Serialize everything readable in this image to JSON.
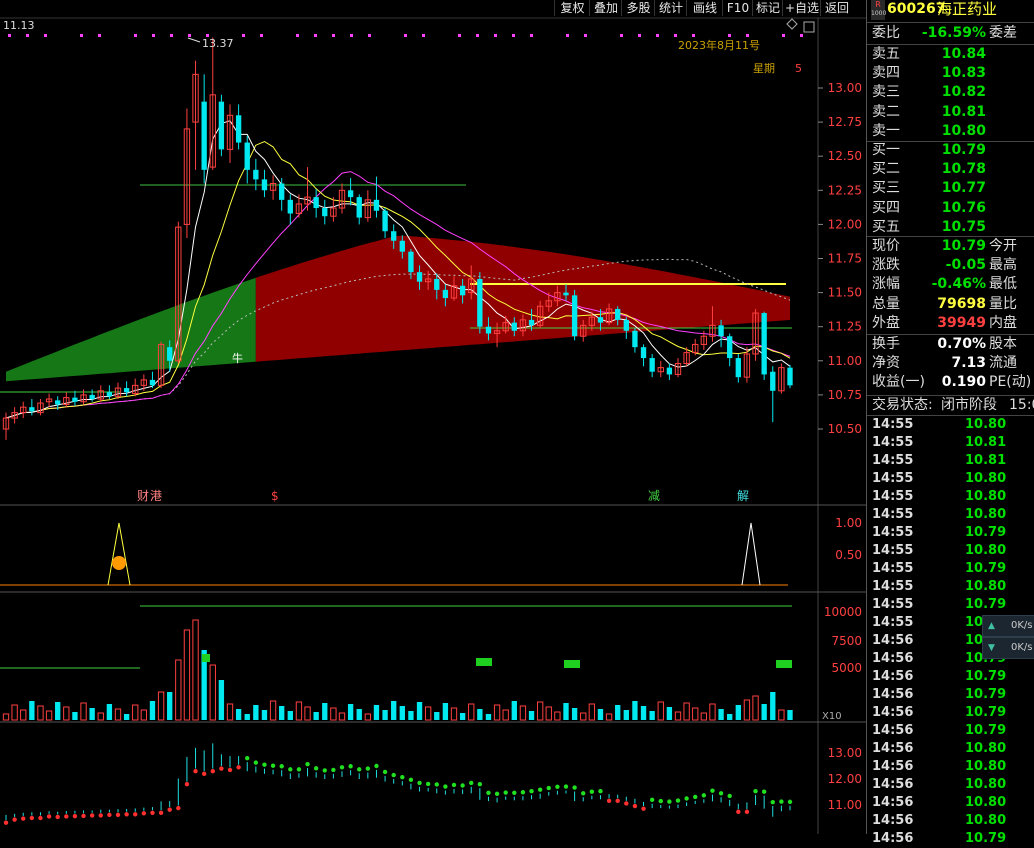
{
  "toolbar": {
    "items": [
      "复权",
      "叠加",
      "多股",
      "统计",
      "画线",
      "F10",
      "标记",
      "+自选",
      "返回"
    ]
  },
  "chart": {
    "price_top_left": "11.13",
    "high_label": "13.37",
    "date_label": "2023年8月11号",
    "weekday_label": "星期",
    "weekday_value": "5",
    "markers": [
      {
        "text": "财"
      },
      {
        "text": "港"
      },
      {
        "text": "$"
      },
      {
        "text": "减"
      },
      {
        "text": "解"
      }
    ],
    "bull_label": "牛",
    "vol_scale_label": "X10",
    "price_axis": [
      "13.00",
      "12.75",
      "12.50",
      "12.25",
      "12.00",
      "11.75",
      "11.50",
      "11.25",
      "11.00",
      "10.75",
      "10.50"
    ],
    "osc_axis": [
      "1.00",
      "0.50"
    ],
    "vol_axis": [
      "10000",
      "7500",
      "5000"
    ],
    "sub_axis": [
      "13.00",
      "12.00",
      "11.00"
    ],
    "colors": {
      "up": "#ff4040",
      "down": "#00e8f0",
      "ma5": "#ffffff",
      "ma10": "#ffff40",
      "ma20": "#ff40ff",
      "ma60": "#cccccc",
      "band": "#a00000",
      "band_green": "#1a8c1a"
    }
  },
  "chart_data": {
    "type": "candlestick",
    "ylim": [
      10.4,
      13.4
    ],
    "candles": [
      [
        10.5,
        10.58,
        10.62,
        10.42
      ],
      [
        10.58,
        10.62,
        10.66,
        10.54
      ],
      [
        10.62,
        10.66,
        10.7,
        10.58
      ],
      [
        10.66,
        10.63,
        10.72,
        10.6
      ],
      [
        10.62,
        10.69,
        10.72,
        10.6
      ],
      [
        10.7,
        10.72,
        10.76,
        10.66
      ],
      [
        10.71,
        10.68,
        10.74,
        10.64
      ],
      [
        10.68,
        10.73,
        10.77,
        10.66
      ],
      [
        10.73,
        10.7,
        10.78,
        10.67
      ],
      [
        10.7,
        10.75,
        10.79,
        10.68
      ],
      [
        10.75,
        10.72,
        10.79,
        10.7
      ],
      [
        10.72,
        10.78,
        10.82,
        10.7
      ],
      [
        10.77,
        10.74,
        10.82,
        10.72
      ],
      [
        10.74,
        10.8,
        10.84,
        10.72
      ],
      [
        10.8,
        10.77,
        10.85,
        10.74
      ],
      [
        10.76,
        10.82,
        10.87,
        10.74
      ],
      [
        10.82,
        10.86,
        10.9,
        10.78
      ],
      [
        10.86,
        10.82,
        10.92,
        10.8
      ],
      [
        10.82,
        11.12,
        11.14,
        10.8
      ],
      [
        11.1,
        11.0,
        11.15,
        10.92
      ],
      [
        11.0,
        11.98,
        12.02,
        10.98
      ],
      [
        12.0,
        12.7,
        12.85,
        11.9
      ],
      [
        12.75,
        13.1,
        13.2,
        12.4
      ],
      [
        12.9,
        12.4,
        13.1,
        12.3
      ],
      [
        12.42,
        12.95,
        13.37,
        12.4
      ],
      [
        12.9,
        12.55,
        12.95,
        12.5
      ],
      [
        12.55,
        12.8,
        12.88,
        12.45
      ],
      [
        12.8,
        12.6,
        12.88,
        12.55
      ],
      [
        12.6,
        12.4,
        12.65,
        12.3
      ],
      [
        12.4,
        12.33,
        12.48,
        12.25
      ],
      [
        12.33,
        12.25,
        12.4,
        12.2
      ],
      [
        12.25,
        12.3,
        12.36,
        12.18
      ],
      [
        12.3,
        12.18,
        12.34,
        12.1
      ],
      [
        12.18,
        12.08,
        12.22,
        12.0
      ],
      [
        12.08,
        12.15,
        12.22,
        12.05
      ],
      [
        12.15,
        12.2,
        12.42,
        12.1
      ],
      [
        12.2,
        12.12,
        12.26,
        12.05
      ],
      [
        12.12,
        12.06,
        12.18,
        12.0
      ],
      [
        12.06,
        12.12,
        12.2,
        12.02
      ],
      [
        12.12,
        12.25,
        12.3,
        12.08
      ],
      [
        12.25,
        12.2,
        12.34,
        12.14
      ],
      [
        12.2,
        12.05,
        12.22,
        12.0
      ],
      [
        12.05,
        12.18,
        12.25,
        12.02
      ],
      [
        12.18,
        12.1,
        12.35,
        12.05
      ],
      [
        12.1,
        11.95,
        12.12,
        11.9
      ],
      [
        11.95,
        11.88,
        12.0,
        11.82
      ],
      [
        11.88,
        11.8,
        11.92,
        11.75
      ],
      [
        11.8,
        11.65,
        11.82,
        11.6
      ],
      [
        11.65,
        11.58,
        11.7,
        11.52
      ],
      [
        11.58,
        11.6,
        11.66,
        11.52
      ],
      [
        11.6,
        11.52,
        11.64,
        11.45
      ],
      [
        11.52,
        11.46,
        11.56,
        11.4
      ],
      [
        11.46,
        11.55,
        11.62,
        11.44
      ],
      [
        11.55,
        11.48,
        11.6,
        11.42
      ],
      [
        11.5,
        11.6,
        11.7,
        11.45
      ],
      [
        11.6,
        11.25,
        11.65,
        11.2
      ],
      [
        11.25,
        11.2,
        11.32,
        11.15
      ],
      [
        11.2,
        11.22,
        11.28,
        11.1
      ],
      [
        11.22,
        11.28,
        11.33,
        11.2
      ],
      [
        11.28,
        11.22,
        11.32,
        11.18
      ],
      [
        11.22,
        11.3,
        11.34,
        11.18
      ],
      [
        11.3,
        11.26,
        11.38,
        11.22
      ],
      [
        11.26,
        11.4,
        11.44,
        11.24
      ],
      [
        11.4,
        11.44,
        11.5,
        11.36
      ],
      [
        11.44,
        11.5,
        11.55,
        11.4
      ],
      [
        11.5,
        11.48,
        11.56,
        11.44
      ],
      [
        11.48,
        11.18,
        11.52,
        11.15
      ],
      [
        11.18,
        11.26,
        11.3,
        11.14
      ],
      [
        11.26,
        11.32,
        11.36,
        11.22
      ],
      [
        11.32,
        11.28,
        11.38,
        11.22
      ],
      [
        11.28,
        11.38,
        11.42,
        11.26
      ],
      [
        11.38,
        11.3,
        11.4,
        11.26
      ],
      [
        11.3,
        11.22,
        11.32,
        11.16
      ],
      [
        11.22,
        11.1,
        11.24,
        11.06
      ],
      [
        11.1,
        11.02,
        11.12,
        10.96
      ],
      [
        11.02,
        10.92,
        11.05,
        10.88
      ],
      [
        10.92,
        10.95,
        11.0,
        10.88
      ],
      [
        10.95,
        10.9,
        10.98,
        10.86
      ],
      [
        10.9,
        10.98,
        11.02,
        10.88
      ],
      [
        10.98,
        11.06,
        11.1,
        10.96
      ],
      [
        11.06,
        11.12,
        11.16,
        11.04
      ],
      [
        11.12,
        11.18,
        11.22,
        11.08
      ],
      [
        11.18,
        11.26,
        11.4,
        11.14
      ],
      [
        11.26,
        11.18,
        11.3,
        11.1
      ],
      [
        11.18,
        11.02,
        11.2,
        10.96
      ],
      [
        11.02,
        10.88,
        11.05,
        10.84
      ],
      [
        10.88,
        11.05,
        11.1,
        10.84
      ],
      [
        11.05,
        11.35,
        11.38,
        11.0
      ],
      [
        11.35,
        10.9,
        11.36,
        10.86
      ],
      [
        10.92,
        10.78,
        10.96,
        10.55
      ],
      [
        10.78,
        10.95,
        10.98,
        10.76
      ],
      [
        10.95,
        10.82,
        10.97,
        10.8
      ]
    ]
  },
  "quote": {
    "badge_r": "R",
    "badge_n": "1000",
    "code": "600267",
    "name": "海正药业",
    "weibi": {
      "label": "委比",
      "value": "-16.59%",
      "right": "委差"
    },
    "asks": [
      {
        "label": "卖五",
        "price": "10.84"
      },
      {
        "label": "卖四",
        "price": "10.83"
      },
      {
        "label": "卖三",
        "price": "10.82"
      },
      {
        "label": "卖二",
        "price": "10.81"
      },
      {
        "label": "卖一",
        "price": "10.80"
      }
    ],
    "bids": [
      {
        "label": "买一",
        "price": "10.79"
      },
      {
        "label": "买二",
        "price": "10.78"
      },
      {
        "label": "买三",
        "price": "10.77"
      },
      {
        "label": "买四",
        "price": "10.76"
      },
      {
        "label": "买五",
        "price": "10.75"
      }
    ],
    "stats": [
      {
        "label": "现价",
        "value": "10.79",
        "right": "今开"
      },
      {
        "label": "涨跌",
        "value": "-0.05",
        "right": "最高"
      },
      {
        "label": "涨幅",
        "value": "-0.46%",
        "right": "最低"
      },
      {
        "label": "总量",
        "value": "79698",
        "right": "量比"
      },
      {
        "label": "外盘",
        "value": "39949",
        "right": "内盘"
      }
    ],
    "stats2": [
      {
        "label": "换手",
        "value": "0.70%",
        "right": "股本"
      },
      {
        "label": "净资",
        "value": "7.13",
        "right": "流通"
      },
      {
        "label": "收益(一)",
        "value": "0.190",
        "right": "PE(动)"
      }
    ],
    "trade_state": {
      "label": "交易状态:",
      "value": "闭市阶段",
      "time": "15:0"
    },
    "ticks": [
      {
        "t": "14:55",
        "p": "10.80",
        "c": "g"
      },
      {
        "t": "14:55",
        "p": "10.81",
        "c": "g"
      },
      {
        "t": "14:55",
        "p": "10.81",
        "c": "g"
      },
      {
        "t": "14:55",
        "p": "10.80",
        "c": "g"
      },
      {
        "t": "14:55",
        "p": "10.80",
        "c": "g"
      },
      {
        "t": "14:55",
        "p": "10.80",
        "c": "g"
      },
      {
        "t": "14:55",
        "p": "10.79",
        "c": "g"
      },
      {
        "t": "14:55",
        "p": "10.80",
        "c": "g"
      },
      {
        "t": "14:55",
        "p": "10.79",
        "c": "g"
      },
      {
        "t": "14:55",
        "p": "10.80",
        "c": "g"
      },
      {
        "t": "14:55",
        "p": "10.79",
        "c": "g"
      },
      {
        "t": "14:55",
        "p": "10.80",
        "c": "g"
      },
      {
        "t": "14:56",
        "p": "10.79",
        "c": "g"
      },
      {
        "t": "14:56",
        "p": "10.79",
        "c": "g"
      },
      {
        "t": "14:56",
        "p": "10.79",
        "c": "g"
      },
      {
        "t": "14:56",
        "p": "10.79",
        "c": "g"
      },
      {
        "t": "14:56",
        "p": "10.79",
        "c": "g"
      },
      {
        "t": "14:56",
        "p": "10.79",
        "c": "g"
      },
      {
        "t": "14:56",
        "p": "10.80",
        "c": "g"
      },
      {
        "t": "14:56",
        "p": "10.80",
        "c": "g"
      },
      {
        "t": "14:56",
        "p": "10.80",
        "c": "g"
      },
      {
        "t": "14:56",
        "p": "10.80",
        "c": "g"
      },
      {
        "t": "14:56",
        "p": "10.80",
        "c": "g"
      },
      {
        "t": "14:56",
        "p": "10.79",
        "c": "g"
      }
    ],
    "speed": [
      {
        "arrow": "up",
        "value": "0K/s"
      },
      {
        "arrow": "down",
        "value": "0K/s"
      }
    ]
  }
}
